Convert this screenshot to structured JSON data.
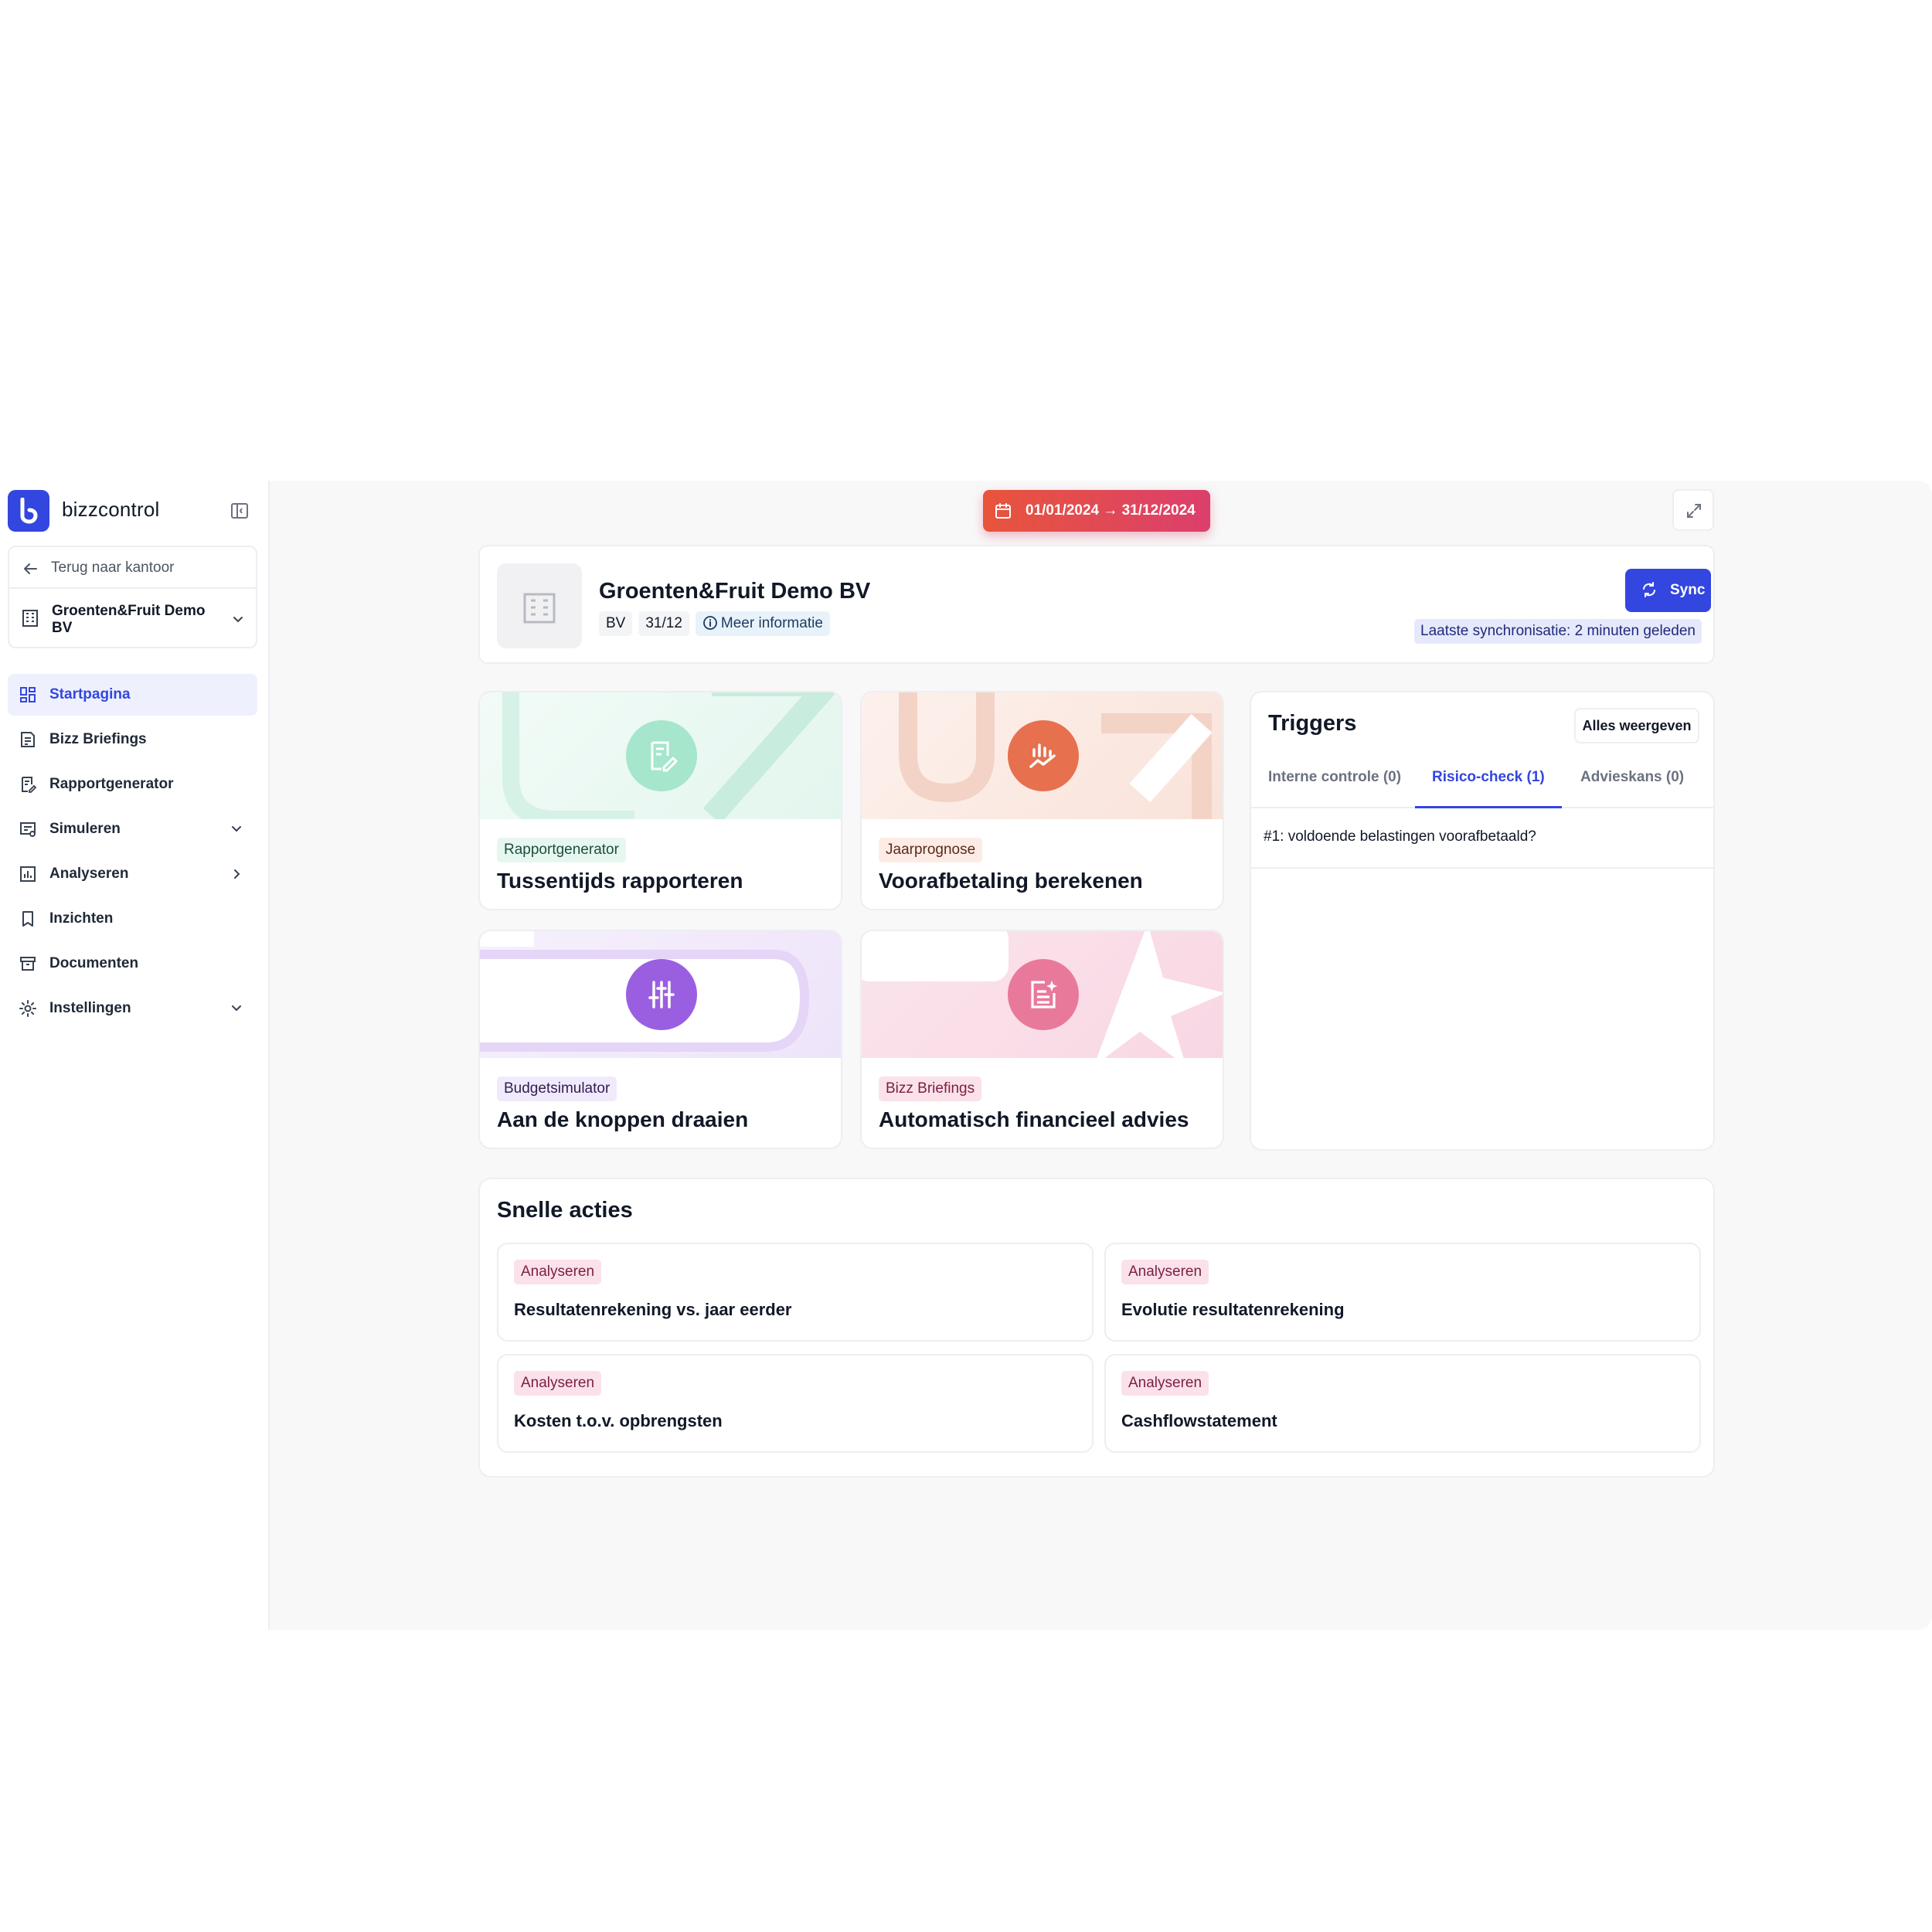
{
  "app": {
    "name": "bizzcontrol",
    "brand_color": "#3346e0"
  },
  "sidebar": {
    "back_label": "Terug naar kantoor",
    "company_name": "Groenten&Fruit Demo BV",
    "items": [
      {
        "label": "Startpagina",
        "icon": "dashboard-icon",
        "active": true,
        "chevron": ""
      },
      {
        "label": "Bizz Briefings",
        "icon": "briefing-icon",
        "active": false,
        "chevron": ""
      },
      {
        "label": "Rapportgenerator",
        "icon": "report-icon",
        "active": false,
        "chevron": ""
      },
      {
        "label": "Simuleren",
        "icon": "simulate-icon",
        "active": false,
        "chevron": "down"
      },
      {
        "label": "Analyseren",
        "icon": "chart-icon",
        "active": false,
        "chevron": "right"
      },
      {
        "label": "Inzichten",
        "icon": "bookmark-icon",
        "active": false,
        "chevron": ""
      },
      {
        "label": "Documenten",
        "icon": "archive-icon",
        "active": false,
        "chevron": ""
      },
      {
        "label": "Instellingen",
        "icon": "gear-icon",
        "active": false,
        "chevron": "down"
      }
    ]
  },
  "header": {
    "date_range": "01/01/2024 → 31/12/2024"
  },
  "company": {
    "title": "Groenten&Fruit Demo BV",
    "tags": [
      "BV",
      "31/12"
    ],
    "info_label": "Meer informatie",
    "sync_label": "Sync",
    "sync_note": "Laatste synchronisatie: 2 minuten geleden"
  },
  "features": [
    {
      "badge": "Rapportgenerator",
      "title": "Tussentijds rapporteren",
      "accent": "#7fdcb8"
    },
    {
      "badge": "Jaarprognose",
      "title": "Voorafbetaling berekenen",
      "accent": "#e7704e"
    },
    {
      "badge": "Budgetsimulator",
      "title": "Aan de knoppen draaien",
      "accent": "#9a5fe0"
    },
    {
      "badge": "Bizz Briefings",
      "title": "Automatisch financieel advies",
      "accent": "#e9799b"
    }
  ],
  "triggers": {
    "title": "Triggers",
    "all_label": "Alles weergeven",
    "tabs": [
      "Interne controle (0)",
      "Risico-check (1)",
      "Advieskans (0)"
    ],
    "active_tab": 1,
    "rows": [
      "#1: voldoende belastingen voorafbetaald?"
    ]
  },
  "quick_actions": {
    "title": "Snelle acties",
    "items": [
      {
        "badge": "Analyseren",
        "label": "Resultatenrekening vs. jaar eerder"
      },
      {
        "badge": "Analyseren",
        "label": "Evolutie resultatenrekening"
      },
      {
        "badge": "Analyseren",
        "label": "Kosten t.o.v. opbrengsten"
      },
      {
        "badge": "Analyseren",
        "label": "Cashflowstatement"
      }
    ]
  }
}
